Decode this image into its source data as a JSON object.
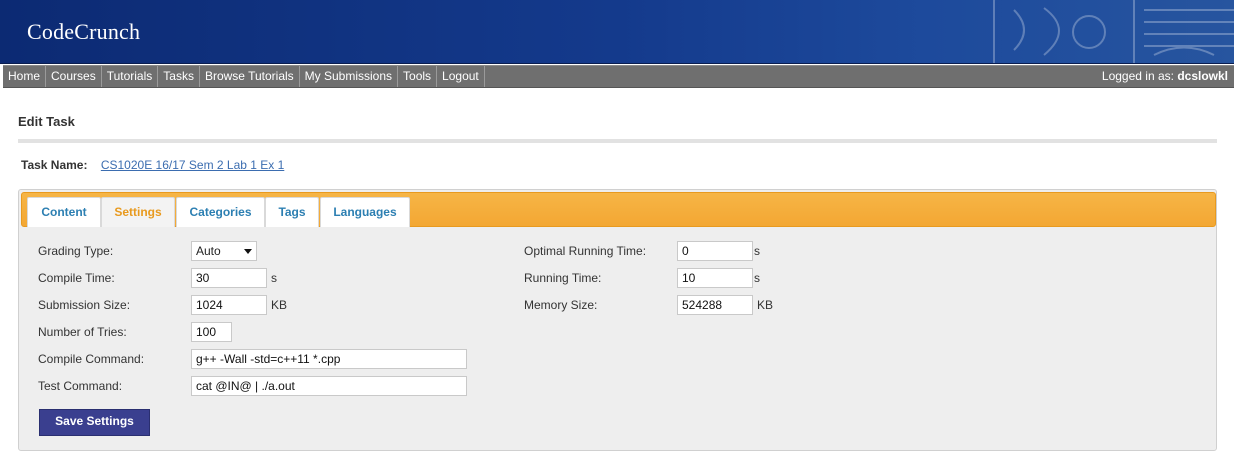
{
  "header": {
    "logo": "CodeCrunch"
  },
  "nav": {
    "items": [
      "Home",
      "Courses",
      "Tutorials",
      "Tasks",
      "Browse Tutorials",
      "My Submissions",
      "Tools",
      "Logout"
    ],
    "login_prefix": "Logged in as:",
    "username": "dcslowkl"
  },
  "page": {
    "title": "Edit Task",
    "task_name_label": "Task Name:",
    "task_name_value": "CS1020E 16/17 Sem 2 Lab 1 Ex 1"
  },
  "tabs": [
    {
      "label": "Content",
      "active": false
    },
    {
      "label": "Settings",
      "active": true
    },
    {
      "label": "Categories",
      "active": false
    },
    {
      "label": "Tags",
      "active": false
    },
    {
      "label": "Languages",
      "active": false
    }
  ],
  "settings": {
    "grading_type": {
      "label": "Grading Type:",
      "value": "Auto"
    },
    "compile_time": {
      "label": "Compile Time:",
      "value": "30",
      "unit": "s"
    },
    "submission_size": {
      "label": "Submission Size:",
      "value": "1024",
      "unit": "KB"
    },
    "number_of_tries": {
      "label": "Number of Tries:",
      "value": "100"
    },
    "compile_command": {
      "label": "Compile Command:",
      "value": "g++ -Wall -std=c++11 *.cpp"
    },
    "test_command": {
      "label": "Test Command:",
      "value": "cat @IN@ | ./a.out"
    },
    "optimal_running_time": {
      "label": "Optimal Running Time:",
      "value": "0",
      "unit": "s"
    },
    "running_time": {
      "label": "Running Time:",
      "value": "10",
      "unit": "s"
    },
    "memory_size": {
      "label": "Memory Size:",
      "value": "524288",
      "unit": "KB"
    },
    "save_label": "Save Settings"
  },
  "colors": {
    "banner": "#143a8c",
    "nav": "#6f6f6f",
    "tabbar": "#f3a733",
    "tab_text": "#2c7fb2",
    "tab_active_text": "#e89a1f",
    "button": "#3a3f8f"
  }
}
